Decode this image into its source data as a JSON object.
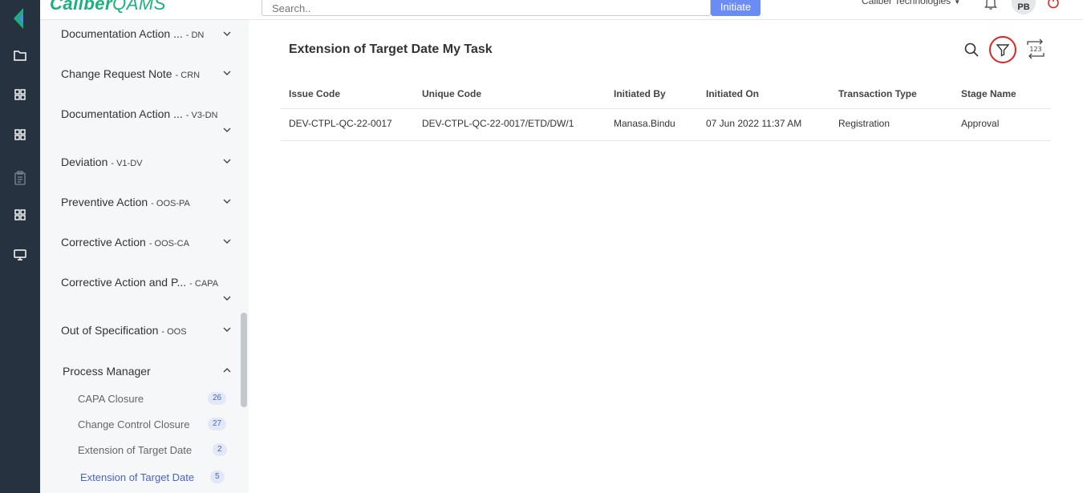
{
  "app": {
    "brand_bold": "Caliber",
    "brand_rest": "QAMS"
  },
  "header": {
    "search_placeholder": "Search..",
    "initiate_label": "Initiate",
    "org_name": "Caliber Technologies",
    "avatar_initials": "PB"
  },
  "rail": {
    "icons": [
      "logo-icon",
      "folder-icon",
      "grid-icon",
      "grid-icon",
      "clipboard-icon",
      "grid-icon",
      "monitor-icon"
    ]
  },
  "sidebar": {
    "items": [
      {
        "label": "Documentation Action ...",
        "code": "- DN"
      },
      {
        "label": "Change Request Note",
        "code": "- CRN"
      },
      {
        "label": "Documentation Action ...",
        "code": "- V3-DN"
      },
      {
        "label": "Deviation",
        "code": "- V1-DV"
      },
      {
        "label": "Preventive Action",
        "code": "- OOS-PA"
      },
      {
        "label": "Corrective Action",
        "code": "- OOS-CA"
      },
      {
        "label": "Corrective Action and P...",
        "code": "- CAPA"
      },
      {
        "label": "Out of Specification",
        "code": "- OOS"
      }
    ],
    "process_manager": {
      "title": "Process Manager",
      "sub_items": [
        {
          "label": "CAPA Closure",
          "count": "26"
        },
        {
          "label": "Change Control Closure",
          "count": "27"
        },
        {
          "label": "Extension of Target Date",
          "count": "2"
        },
        {
          "label": "Extension of Target Date",
          "count": "5"
        }
      ]
    }
  },
  "main": {
    "title": "Extension of Target Date My Task",
    "columns": [
      "Issue Code",
      "Unique Code",
      "Initiated By",
      "Initiated On",
      "Transaction Type",
      "Stage Name"
    ],
    "rows": [
      [
        "DEV-CTPL-QC-22-0017",
        "DEV-CTPL-QC-22-0017/ETD/DW/1",
        "Manasa.Bindu",
        "07 Jun 2022 11:37 AM",
        "Registration",
        "Approval"
      ]
    ],
    "toolbar_icons": [
      "search-icon",
      "filter-icon",
      "refresh-123-icon"
    ]
  },
  "colors": {
    "rail": "#26323f",
    "accent": "#6b8cf5",
    "brand": "#1bb17a",
    "highlight_ring": "#e02424",
    "active_link": "#4a63c9"
  }
}
